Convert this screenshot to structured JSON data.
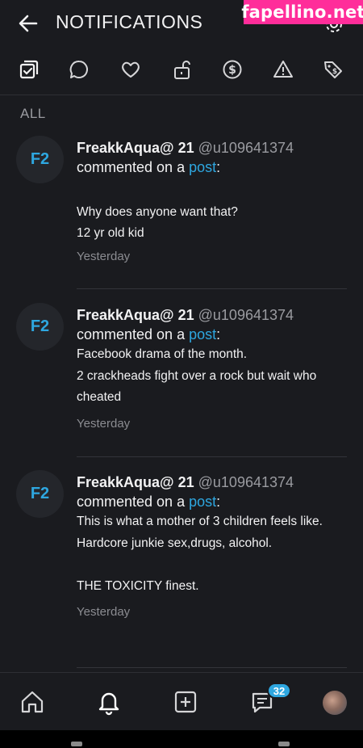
{
  "header": {
    "title": "NOTIFICATIONS",
    "watermark": "fapellino.net"
  },
  "filters": [
    {
      "icon": "all-notifications-icon"
    },
    {
      "icon": "comment-icon"
    },
    {
      "icon": "heart-icon"
    },
    {
      "icon": "unlock-icon"
    },
    {
      "icon": "dollar-icon"
    },
    {
      "icon": "warning-icon"
    },
    {
      "icon": "tag-icon"
    }
  ],
  "section_label": "ALL",
  "notifications": [
    {
      "avatar": "F2",
      "name": "FreakkAqua@ 21",
      "handle": "@u109641374",
      "action": "commented on a ",
      "link": "post",
      "punct": ":",
      "body": "\nWhy does anyone want that?\n12 yr old kid",
      "time": "Yesterday"
    },
    {
      "avatar": "F2",
      "name": "FreakkAqua@ 21",
      "handle": "@u109641374",
      "action": "commented on a ",
      "link": "post",
      "punct": ":",
      "body": "Facebook drama of the month.\n2 crackheads fight over a rock but wait who cheated",
      "time": "Yesterday"
    },
    {
      "avatar": "F2",
      "name": "FreakkAqua@ 21",
      "handle": "@u109641374",
      "action": "commented on a ",
      "link": "post",
      "punct": ":",
      "body": "This is what a mother of 3 children feels like. Hardcore junkie sex,drugs, alcohol.\n\nTHE TOXICITY finest.\n",
      "time": "Yesterday"
    }
  ],
  "bottom_nav": {
    "items": [
      "home-icon",
      "bell-icon",
      "plus-square-icon",
      "messages-icon",
      "profile-avatar"
    ],
    "messages_badge": "32"
  },
  "colors": {
    "background": "#1a1b1f",
    "accent": "#2ea7e0",
    "watermark": "#ff2d9a"
  }
}
